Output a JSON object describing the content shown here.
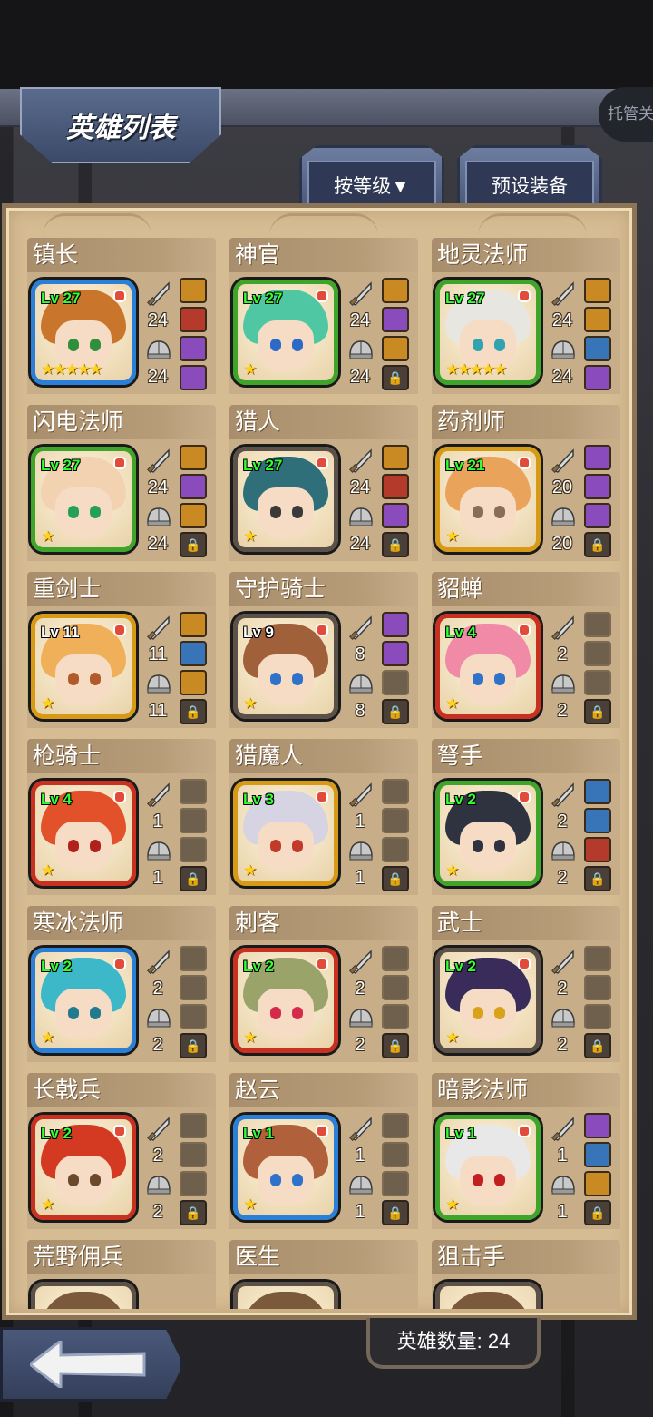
{
  "header": {
    "title": "英雄列表",
    "trustee_label": "托管关"
  },
  "tabs": {
    "sort_label": "按等级▼",
    "preset_label": "预设装备"
  },
  "footer": {
    "hero_count_label": "英雄数量: 24"
  },
  "colors": {
    "level_green": "#33ff33",
    "panel_bg": "#d6bc93",
    "name_bar": "#b79c78",
    "star": "#ffd21a"
  },
  "heroes": [
    {
      "name": "镇长",
      "level": "Lv 27",
      "stars": "★★★★★",
      "attack": "24",
      "defense": "24",
      "frame": "blue",
      "hair": "#c9762c",
      "eye": "#2f8f3c",
      "slots": [
        "gold",
        "red",
        "item",
        "item"
      ]
    },
    {
      "name": "神官",
      "level": "Lv 27",
      "stars": "★",
      "attack": "24",
      "defense": "24",
      "frame": "green",
      "hair": "#4fc7a3",
      "eye": "#2c69c8",
      "slots": [
        "gold",
        "item",
        "gold",
        "lock"
      ]
    },
    {
      "name": "地灵法师",
      "level": "Lv 27",
      "stars": "★★★★★",
      "attack": "24",
      "defense": "24",
      "frame": "green",
      "hair": "#e8e6e0",
      "eye": "#2fa3b0",
      "slots": [
        "gold",
        "gold",
        "blue",
        "item"
      ]
    },
    {
      "name": "闪电法师",
      "level": "Lv 27",
      "stars": "★",
      "attack": "24",
      "defense": "24",
      "frame": "green",
      "hair": "#f2d2b0",
      "eye": "#26a058",
      "slots": [
        "gold",
        "item",
        "gold",
        "lock"
      ]
    },
    {
      "name": "猎人",
      "level": "Lv 27",
      "stars": "★",
      "attack": "24",
      "defense": "24",
      "frame": "gray",
      "hair": "#2e6f7a",
      "eye": "#3a3a3a",
      "slots": [
        "gold",
        "red",
        "item",
        "lock"
      ]
    },
    {
      "name": "药剂师",
      "level": "Lv 21",
      "stars": "★",
      "attack": "20",
      "defense": "20",
      "frame": "gold",
      "hair": "#e9a35a",
      "eye": "#8a6c58",
      "slots": [
        "item",
        "item",
        "item",
        "lock"
      ]
    },
    {
      "name": "重剑士",
      "level": "Lv 11",
      "stars": "★",
      "attack": "11",
      "defense": "11",
      "frame": "gold",
      "hair": "#f0b05a",
      "eye": "#b35a2a",
      "slots": [
        "gold",
        "blue",
        "gold",
        "lock"
      ]
    },
    {
      "name": "守护骑士",
      "level": "Lv 9",
      "stars": "★",
      "attack": "8",
      "defense": "8",
      "frame": "gray",
      "hair": "#a0603a",
      "eye": "#2e72c9",
      "slots": [
        "item",
        "item",
        "empty",
        "lock"
      ]
    },
    {
      "name": "貂蝉",
      "level": "Lv 4",
      "stars": "★",
      "attack": "2",
      "defense": "2",
      "frame": "red",
      "hair": "#f08aa6",
      "eye": "#2e72c9",
      "slots": [
        "empty",
        "empty",
        "empty",
        "lock"
      ]
    },
    {
      "name": "枪骑士",
      "level": "Lv 4",
      "stars": "★",
      "attack": "1",
      "defense": "1",
      "frame": "red",
      "hair": "#e2512a",
      "eye": "#b0201c",
      "slots": [
        "empty",
        "empty",
        "empty",
        "lock"
      ]
    },
    {
      "name": "猎魔人",
      "level": "Lv 3",
      "stars": "★",
      "attack": "1",
      "defense": "1",
      "frame": "gold",
      "hair": "#d6d3e2",
      "eye": "#c23a2a",
      "slots": [
        "empty",
        "empty",
        "empty",
        "lock"
      ]
    },
    {
      "name": "弩手",
      "level": "Lv 2",
      "stars": "★",
      "attack": "2",
      "defense": "2",
      "frame": "green",
      "hair": "#2f3340",
      "eye": "#2f3340",
      "slots": [
        "blue",
        "blue",
        "red",
        "lock"
      ]
    },
    {
      "name": "寒冰法师",
      "level": "Lv 2",
      "stars": "★",
      "attack": "2",
      "defense": "2",
      "frame": "blue",
      "hair": "#3cb8c8",
      "eye": "#227a8e",
      "slots": [
        "empty",
        "empty",
        "empty",
        "lock"
      ]
    },
    {
      "name": "刺客",
      "level": "Lv 2",
      "stars": "★",
      "attack": "2",
      "defense": "2",
      "frame": "red",
      "hair": "#9aa36a",
      "eye": "#d62a4a",
      "slots": [
        "empty",
        "empty",
        "empty",
        "lock"
      ]
    },
    {
      "name": "武士",
      "level": "Lv 2",
      "stars": "★",
      "attack": "2",
      "defense": "2",
      "frame": "gray",
      "hair": "#3a2c5a",
      "eye": "#d8a31a",
      "slots": [
        "empty",
        "empty",
        "empty",
        "lock"
      ]
    },
    {
      "name": "长戟兵",
      "level": "Lv 2",
      "stars": "★",
      "attack": "2",
      "defense": "2",
      "frame": "red",
      "hair": "#d43a22",
      "eye": "#6a4a2a",
      "slots": [
        "empty",
        "empty",
        "empty",
        "lock"
      ]
    },
    {
      "name": "赵云",
      "level": "Lv 1",
      "stars": "★",
      "attack": "1",
      "defense": "1",
      "frame": "blue",
      "hair": "#b0603a",
      "eye": "#2e72c9",
      "slots": [
        "empty",
        "empty",
        "empty",
        "lock"
      ]
    },
    {
      "name": "暗影法师",
      "level": "Lv 1",
      "stars": "★",
      "attack": "1",
      "defense": "1",
      "frame": "green",
      "hair": "#e8e8e8",
      "eye": "#c22020",
      "slots": [
        "item",
        "blue",
        "gold",
        "lock"
      ]
    },
    {
      "name": "荒野佣兵",
      "level": "",
      "stars": "",
      "attack": "",
      "defense": "",
      "frame": "gray",
      "hair": "#7a5a3a",
      "eye": "#333",
      "slots": []
    },
    {
      "name": "医生",
      "level": "",
      "stars": "",
      "attack": "",
      "defense": "",
      "frame": "gray",
      "hair": "#7a5a3a",
      "eye": "#333",
      "slots": []
    },
    {
      "name": "狙击手",
      "level": "",
      "stars": "",
      "attack": "",
      "defense": "",
      "frame": "gray",
      "hair": "#7a5a3a",
      "eye": "#333",
      "slots": []
    }
  ]
}
